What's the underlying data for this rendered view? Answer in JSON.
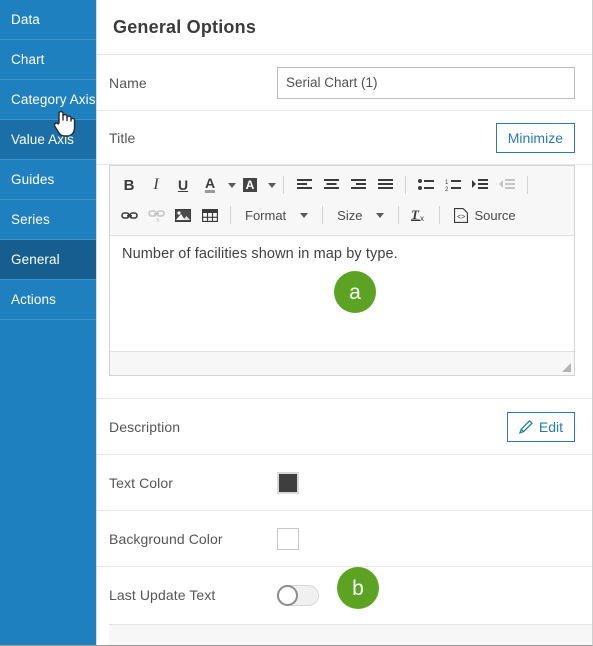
{
  "sidebar": {
    "items": [
      {
        "label": "Data",
        "state": "normal"
      },
      {
        "label": "Chart",
        "state": "normal"
      },
      {
        "label": "Category Axis",
        "state": "normal"
      },
      {
        "label": "Value Axis",
        "state": "hover"
      },
      {
        "label": "Guides",
        "state": "normal"
      },
      {
        "label": "Series",
        "state": "normal"
      },
      {
        "label": "General",
        "state": "selected"
      },
      {
        "label": "Actions",
        "state": "normal"
      }
    ],
    "accent_color": "#1f80c0",
    "selected_color": "#175e90",
    "hover_color": "#1a6fa8"
  },
  "panel": {
    "title": "General Options"
  },
  "fields": {
    "name": {
      "label": "Name",
      "value": "Serial Chart (1)",
      "placeholder": "Serial Chart (1)"
    },
    "title": {
      "label": "Title",
      "minimize_label": "Minimize",
      "editor_text": "Number of facilities shown in map by type."
    },
    "description": {
      "label": "Description",
      "edit_label": "Edit"
    },
    "text_color": {
      "label": "Text Color",
      "value": "#3e3e3e"
    },
    "background_color": {
      "label": "Background Color",
      "value": "#ffffff"
    },
    "last_update_text": {
      "label": "Last Update Text",
      "enabled": "off"
    }
  },
  "editor_toolbar": {
    "row1": [
      {
        "name": "bold-icon",
        "label": "B"
      },
      {
        "name": "italic-icon",
        "label": "I"
      },
      {
        "name": "underline-icon",
        "label": "U"
      },
      {
        "name": "text-color-icon",
        "label": "A"
      },
      {
        "name": "background-color-icon",
        "label": "A"
      },
      {
        "name": "align-left-icon",
        "label": ""
      },
      {
        "name": "align-center-icon",
        "label": ""
      },
      {
        "name": "align-right-icon",
        "label": ""
      },
      {
        "name": "align-justify-icon",
        "label": ""
      },
      {
        "name": "bulleted-list-icon",
        "label": ""
      },
      {
        "name": "numbered-list-icon",
        "label": ""
      },
      {
        "name": "indent-increase-icon",
        "label": ""
      },
      {
        "name": "indent-decrease-icon",
        "label": ""
      }
    ],
    "row2": [
      {
        "name": "link-icon",
        "label": ""
      },
      {
        "name": "unlink-icon",
        "label": ""
      },
      {
        "name": "image-icon",
        "label": ""
      },
      {
        "name": "table-icon",
        "label": ""
      },
      {
        "name": "format-dropdown",
        "label": "Format"
      },
      {
        "name": "size-dropdown",
        "label": "Size"
      },
      {
        "name": "remove-format-icon",
        "label": ""
      },
      {
        "name": "source-button",
        "label": "Source"
      }
    ]
  },
  "callouts": [
    {
      "id": "a",
      "label": "a",
      "color": "#5ca223"
    },
    {
      "id": "b",
      "label": "b",
      "color": "#5ca223"
    }
  ]
}
